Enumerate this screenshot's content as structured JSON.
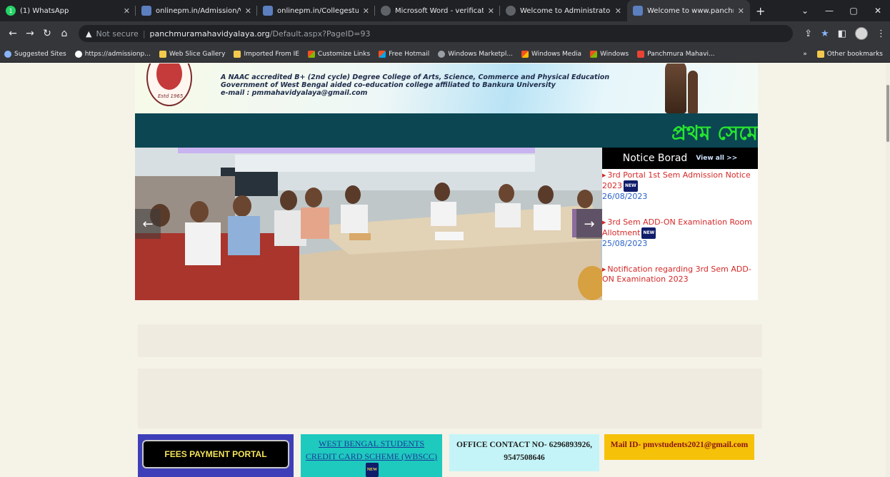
{
  "tabs": [
    {
      "title": "(1) WhatsApp",
      "icon": "whatsapp-icon",
      "color": "#25d366",
      "badge": "1"
    },
    {
      "title": "onlinepm.in/Admission/View...",
      "icon": "site-icon",
      "color": "#5b7fbf"
    },
    {
      "title": "onlinepm.in/Collegestudent/...",
      "icon": "site-icon",
      "color": "#5b7fbf"
    },
    {
      "title": "Microsoft Word - verification",
      "icon": "globe-icon",
      "color": "#9aa0a6"
    },
    {
      "title": "Welcome to Administrator ar...",
      "icon": "globe-icon",
      "color": "#9aa0a6"
    },
    {
      "title": "Welcome to www.panchmura...",
      "icon": "site-icon",
      "color": "#5b7fbf"
    }
  ],
  "toolbar": {
    "security_label": "Not secure",
    "url_host": "panchmuramahavidyalaya.org",
    "url_path": "/Default.aspx?PageID=93"
  },
  "bookmarks": [
    {
      "label": "Suggested Sites",
      "color": "#8ab4f8"
    },
    {
      "label": "https://admissionp...",
      "color": "#ffffff"
    },
    {
      "label": "Web Slice Gallery",
      "color": "#f2c94c"
    },
    {
      "label": "Imported From IE",
      "color": "#f2c94c"
    },
    {
      "label": "Customize Links",
      "color": "#f25022"
    },
    {
      "label": "Free Hotmail",
      "color": "#f25022"
    },
    {
      "label": "Windows Marketpl...",
      "color": "#9aa0a6"
    },
    {
      "label": "Windows Media",
      "color": "#f25022"
    },
    {
      "label": "Windows",
      "color": "#f25022"
    },
    {
      "label": "Panchmura Mahavi...",
      "color": "#ea4335"
    }
  ],
  "bookmarks_other": "Other bookmarks",
  "header": {
    "line1": "A NAAC accredited B+ (2nd cycle) Degree College of Arts, Science, Commerce and Physical Education",
    "line2": "Government of West Bengal aided co-education college affiliated to Bankura University",
    "line3": "e-mail : pmmahavidyalaya@gmail.com",
    "estd": "Estd 1965"
  },
  "marquee": "প্রথম সেমে",
  "notice": {
    "title": "Notice Borad",
    "view_all": "View all >>",
    "new_label": "NEW",
    "items": [
      {
        "title": "3rd Portal 1st Sem Admission Notice 2023",
        "date": "26/08/2023"
      },
      {
        "title": "3rd Sem ADD-ON Examination Room Allotment",
        "date": "25/08/2023"
      },
      {
        "title": "Notification regarding 3rd Sem ADD-ON Examination 2023",
        "date": ""
      }
    ]
  },
  "bottom": {
    "fees_label": "FEES PAYMENT PORTAL",
    "wbscc_line1": "WEST BENGAL STUDENTS",
    "wbscc_line2": "CREDIT CARD SCHEME (WBSCC)",
    "office_line1": "OFFICE CONTACT NO- 6296893926,",
    "office_line2": "9547508646",
    "mail": "Mail ID- pmvstudents2021@gmail.com"
  }
}
